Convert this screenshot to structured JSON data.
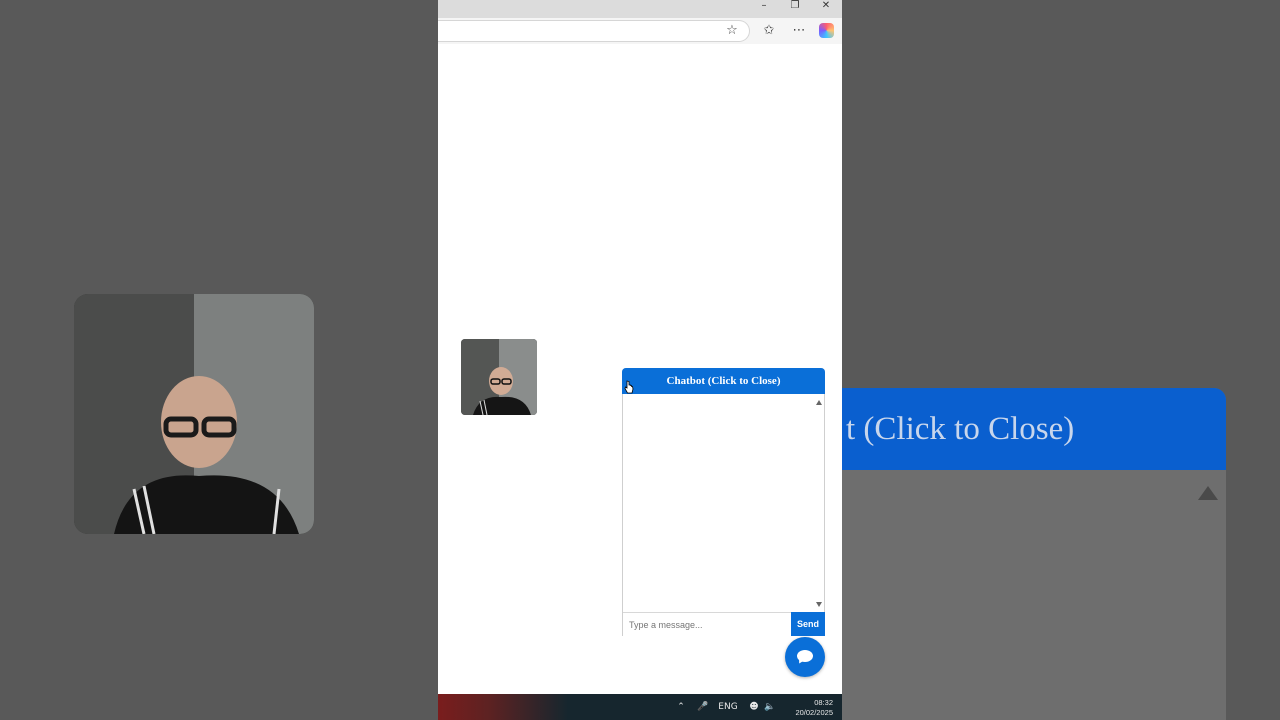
{
  "background": {
    "chat_header_text": "t (Click to Close)"
  },
  "window_controls": {
    "minimize_icon": "minimize-icon",
    "restore_icon": "restore-icon",
    "close_icon": "close-icon"
  },
  "toolbar": {
    "favorite_icon": "star-icon",
    "favorites_icon": "favorites-icon",
    "more_icon": "more-icon",
    "copilot_icon": "copilot-icon"
  },
  "chatbot": {
    "header": "Chatbot (Click to Close)",
    "input_placeholder": "Type a message...",
    "send_label": "Send",
    "toggle_icon": "chat-bubble-icon"
  },
  "taskbar": {
    "language": "ENG",
    "time": "08:32",
    "date": "20/02/2025"
  },
  "colors": {
    "accent": "#0a6fd8",
    "taskbar": "#16262e"
  }
}
